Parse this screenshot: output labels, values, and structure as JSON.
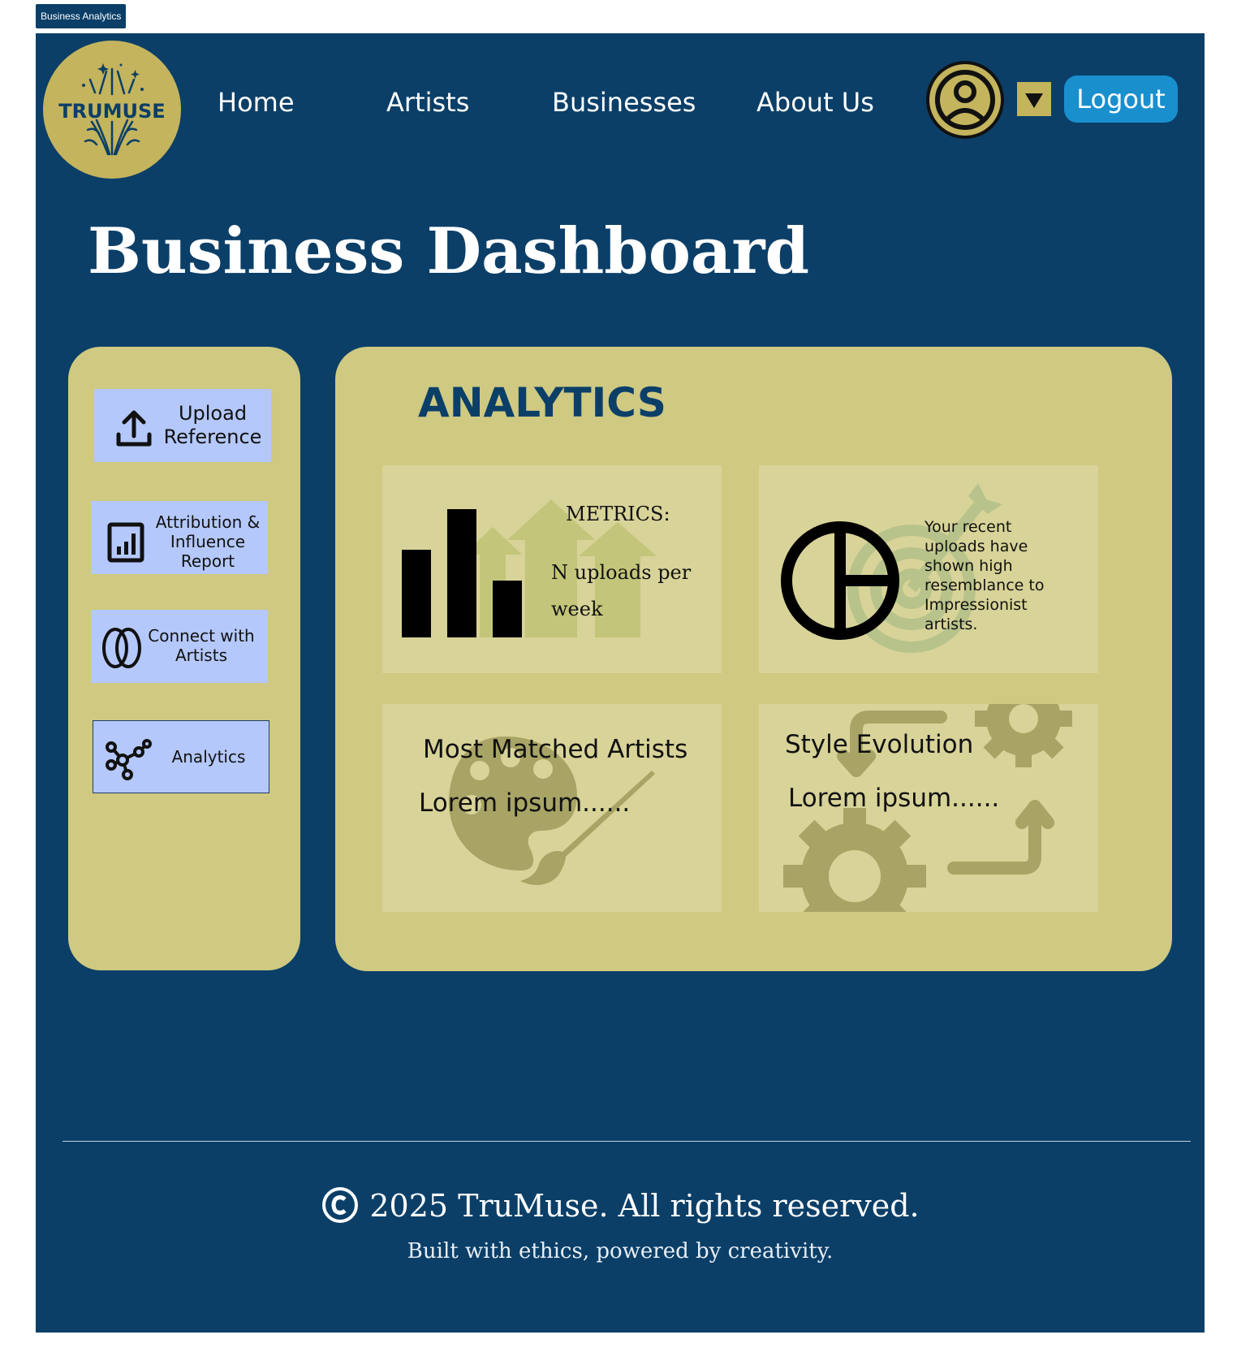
{
  "frame_tab": "Business Analytics",
  "brand": {
    "logo_text": "TRUMUSE"
  },
  "nav": {
    "home": "Home",
    "artists": "Artists",
    "businesses": "Businesses",
    "about": "About Us"
  },
  "header": {
    "logout": "Logout"
  },
  "page_title": "Business Dashboard",
  "sidebar": {
    "upload_line1": "Upload",
    "upload_line2": "Reference",
    "attribution_line1": "Attribution &",
    "attribution_line2": "Influence",
    "attribution_line3": "Report",
    "connect_line1": "Connect with",
    "connect_line2": "Artists",
    "analytics": "Analytics"
  },
  "analytics": {
    "title": "ANALYTICS",
    "metrics_title": "METRICS:",
    "metrics_line1": "N uploads per",
    "metrics_line2": "week",
    "resemblance_line1": "Your recent",
    "resemblance_line2": "uploads have",
    "resemblance_line3": "shown high",
    "resemblance_line4": "resemblance to",
    "resemblance_line5": "Impressionist",
    "resemblance_line6": "artists.",
    "matched_title": "Most Matched Artists",
    "matched_body": "Lorem ipsum......",
    "style_title": "Style Evolution",
    "style_body": "Lorem ipsum......"
  },
  "footer": {
    "copyright": "2025 TruMuse. All rights reserved.",
    "tagline": "Built with ethics, powered by creativity."
  },
  "colors": {
    "navy": "#0b3f68",
    "gold": "#c3b45d",
    "panel": "#cfc982",
    "card": "#d8d398",
    "button_blue": "#b4c8fb",
    "logout_blue": "#1a8fce"
  }
}
